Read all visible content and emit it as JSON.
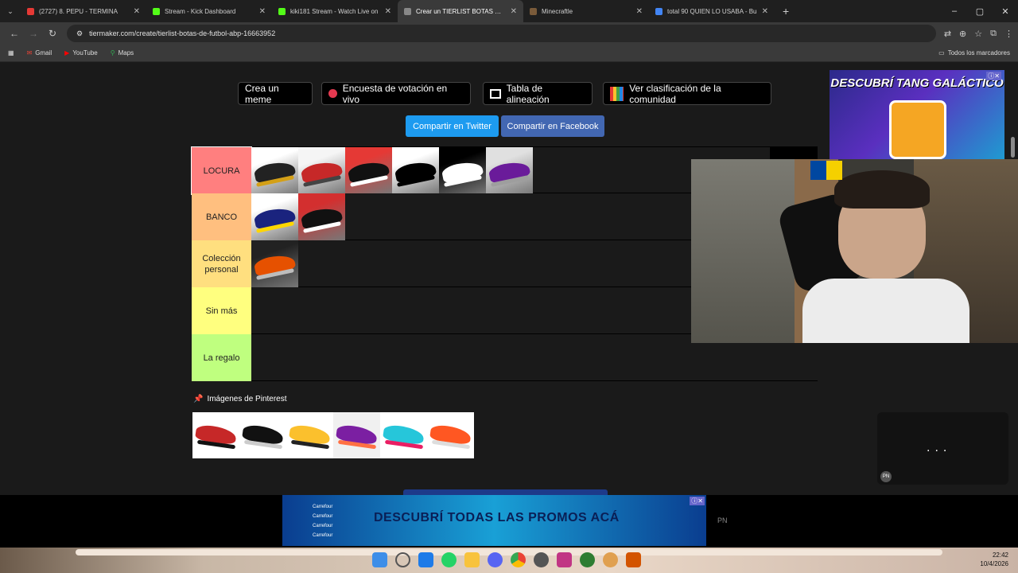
{
  "browser": {
    "tabs": [
      {
        "title": "(2727) 8. PEPU - TERMINA",
        "color": "#e53935"
      },
      {
        "title": "Stream - Kick Dashboard",
        "color": "#53fc18"
      },
      {
        "title": "kiki181 Stream - Watch Live on",
        "color": "#53fc18"
      },
      {
        "title": "Crear un TIERLIST BOTAS DE FU",
        "color": "#888888",
        "active": true
      },
      {
        "title": "Minecraftle",
        "color": "#7a5b3a"
      },
      {
        "title": "total 90 QUIEN LO USABA - Bu",
        "color": "#4285f4"
      }
    ],
    "url": "tiermaker.com/create/tierlist-botas-de-futbol-abp-16663952",
    "bookmarks": [
      "Gmail",
      "YouTube",
      "Maps"
    ],
    "bookmarks_right": "Todos los marcadores"
  },
  "toolbar": {
    "meme": "Crea un meme",
    "poll": "Encuesta de votación en vivo",
    "lineup": "Tabla de alineación",
    "community": "Ver clasificación de la comunidad",
    "twitter": "Compartir en Twitter",
    "facebook": "Compartir en Facebook"
  },
  "tiers": [
    {
      "label": "LOCURA",
      "color": "#ff7f7f",
      "items": 6
    },
    {
      "label": "BANCO",
      "color": "#ffbf7f",
      "items": 2
    },
    {
      "label": "Colección personal",
      "color": "#ffdf7f",
      "items": 1
    },
    {
      "label": "Sin más",
      "color": "#ffff7f",
      "items": 0
    },
    {
      "label": "La regalo",
      "color": "#bfff7f",
      "items": 0
    }
  ],
  "pinterest_title": "Imágenes de Pinterest",
  "ads": {
    "top": "DESCUBRÍ TANG GALÁCTICO",
    "bottom": "DESCUBRÍ TODAS LAS PROMOS ACÁ",
    "brand": "Carrefour",
    "pn": "PN"
  },
  "clock": {
    "time": "22:42",
    "date": "10/4/2026"
  }
}
